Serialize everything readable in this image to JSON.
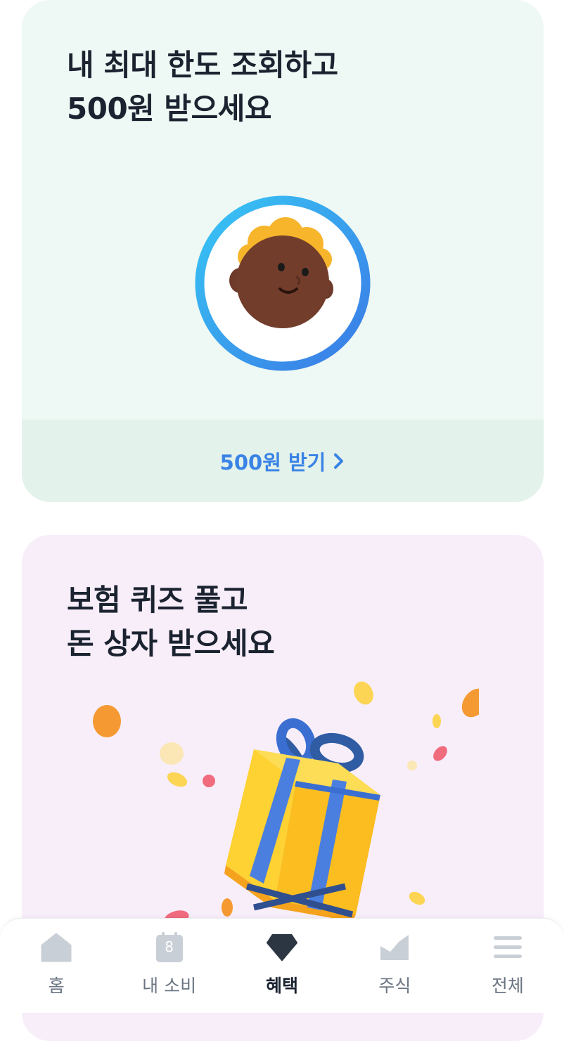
{
  "cards": [
    {
      "title": "내 최대 한도 조회하고\n500원 받으세요",
      "cta_label": "500원 받기",
      "illustration": "avatar-face"
    },
    {
      "title": "보험 퀴즈 풀고\n돈 상자 받으세요",
      "illustration": "gift-box-with-confetti"
    }
  ],
  "tabbar": {
    "items": [
      {
        "label": "홈",
        "icon": "home-icon",
        "active": false
      },
      {
        "label": "내 소비",
        "icon": "calendar-icon",
        "calendar_number": "8",
        "active": false
      },
      {
        "label": "혜택",
        "icon": "diamond-icon",
        "active": true
      },
      {
        "label": "주식",
        "icon": "chart-icon",
        "active": false
      },
      {
        "label": "전체",
        "icon": "menu-icon",
        "active": false
      }
    ]
  },
  "colors": {
    "card1_bg": "#eef8f4",
    "card1_footer": "#e3f2ea",
    "card2_bg": "#f8eefa",
    "accent": "#3a83e6",
    "title_text": "#1b2330",
    "tab_inactive": "#6b7583"
  }
}
